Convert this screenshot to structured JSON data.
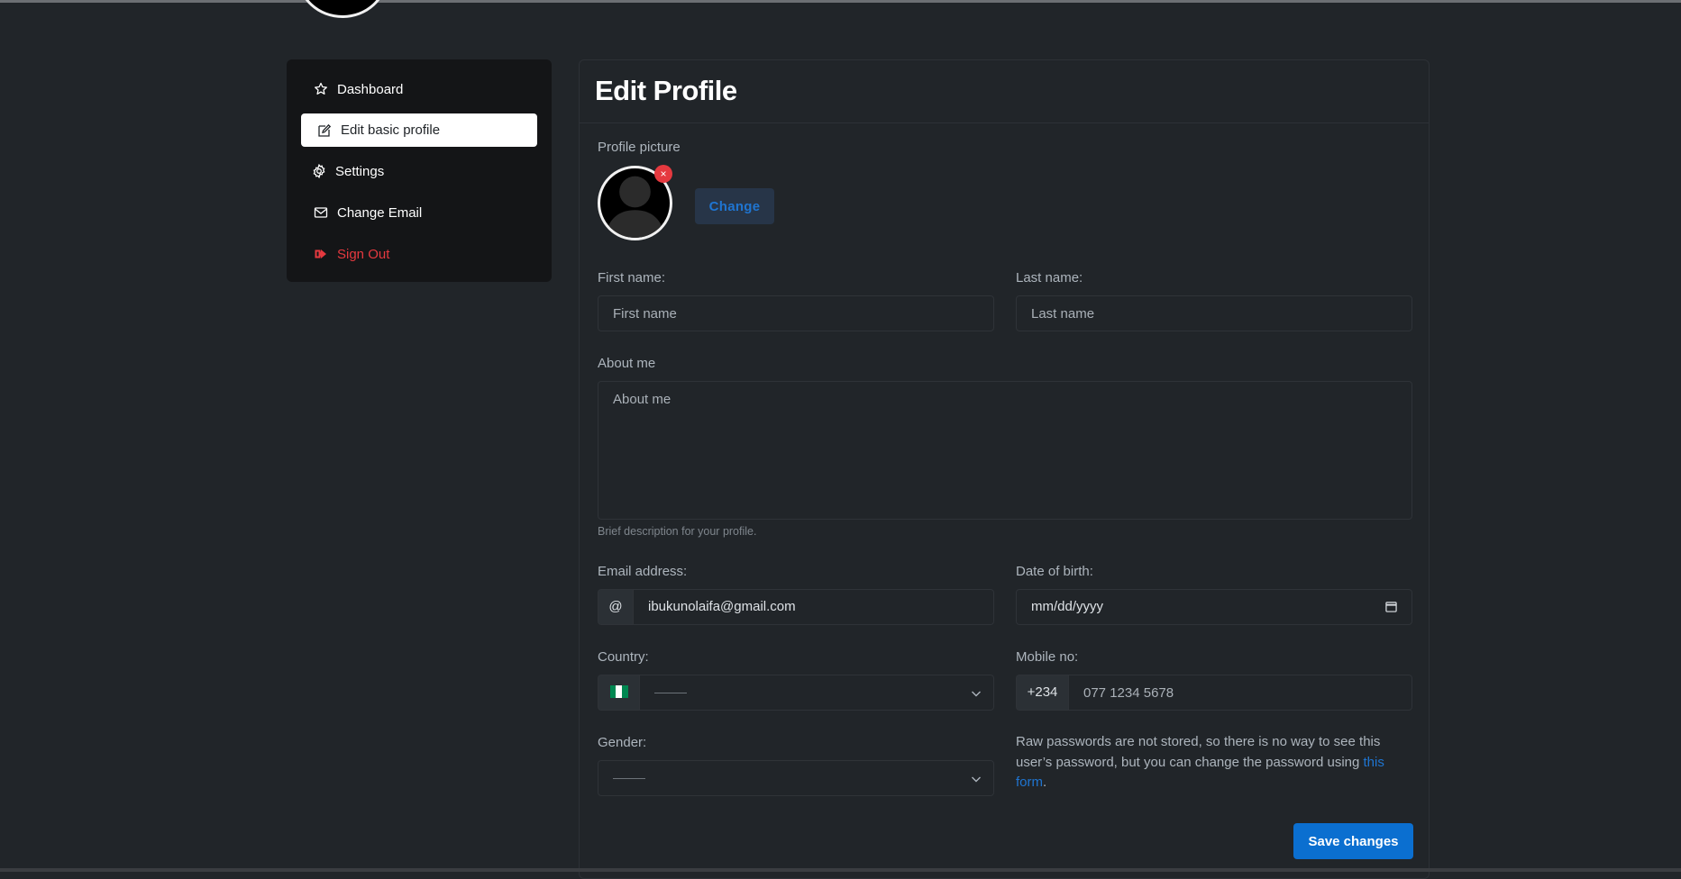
{
  "sidebar": {
    "items": [
      {
        "label": "Dashboard",
        "icon": "star-icon"
      },
      {
        "label": "Edit basic profile",
        "icon": "edit-icon"
      },
      {
        "label": "Settings",
        "icon": "gear-icon"
      },
      {
        "label": "Change Email",
        "icon": "envelope-icon"
      },
      {
        "label": "Sign Out",
        "icon": "sign-out-icon"
      }
    ],
    "active_index": 1
  },
  "main": {
    "title": "Edit Profile",
    "profile_picture": {
      "label": "Profile picture",
      "change_label": "Change",
      "remove_symbol": "×"
    },
    "first_name": {
      "label": "First name:",
      "placeholder": "First name",
      "value": ""
    },
    "last_name": {
      "label": "Last name:",
      "placeholder": "Last name",
      "value": ""
    },
    "about": {
      "label": "About me",
      "placeholder": "About me",
      "help": "Brief description for your profile."
    },
    "email": {
      "label": "Email address:",
      "prefix": "@",
      "value": "ibukunolaifa@gmail.com"
    },
    "dob": {
      "label": "Date of birth:",
      "placeholder": "mm/dd/yyyy"
    },
    "country": {
      "label": "Country:",
      "flag": "nigeria-flag",
      "selected": ""
    },
    "mobile": {
      "label": "Mobile no:",
      "prefix": "+234",
      "placeholder": "077 1234 5678"
    },
    "gender": {
      "label": "Gender:",
      "selected": ""
    },
    "password_note": {
      "text": "Raw passwords are not stored, so there is no way to see this user’s password, but you can change the password using ",
      "link": "this form",
      "suffix": "."
    },
    "save_label": "Save changes"
  },
  "colors": {
    "background": "#212529",
    "sidebar": "#141517",
    "accent": "#0b6fd0",
    "danger": "#e5393f",
    "link": "#1f75d1"
  }
}
